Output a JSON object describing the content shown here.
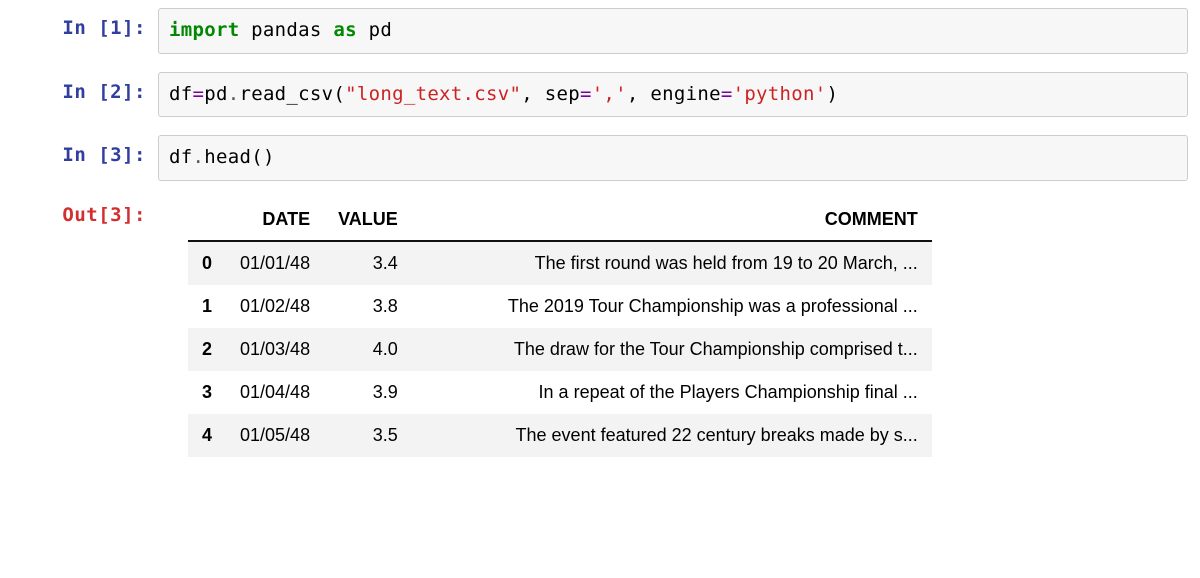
{
  "cells": {
    "in1_prompt": "In [1]:",
    "in2_prompt": "In [2]:",
    "in3_prompt": "In [3]:",
    "out3_prompt": "Out[3]:"
  },
  "code1": {
    "kw_import": "import",
    "name_pandas": " pandas ",
    "kw_as": "as",
    "name_pd": " pd"
  },
  "code2": {
    "name_df": "df",
    "op_eq": "=",
    "name_pd": "pd",
    "dot": ".",
    "fn": "read_csv",
    "lp": "(",
    "str_file": "\"long_text.csv\"",
    "comma1": ", ",
    "arg_sep": "sep",
    "eq1": "=",
    "str_sep": "','",
    "comma2": ", ",
    "arg_engine": "engine",
    "eq2": "=",
    "str_engine": "'python'",
    "rp": ")"
  },
  "code3": {
    "name_df": "df",
    "dot": ".",
    "fn": "head",
    "lp": "(",
    "rp": ")"
  },
  "df": {
    "columns": {
      "date": "DATE",
      "value": "VALUE",
      "comment": "COMMENT"
    },
    "rows": [
      {
        "idx": "0",
        "date": "01/01/48",
        "value": "3.4",
        "comment": "The first round was held from 19 to 20 March, ..."
      },
      {
        "idx": "1",
        "date": "01/02/48",
        "value": "3.8",
        "comment": "The 2019 Tour Championship was a professional ..."
      },
      {
        "idx": "2",
        "date": "01/03/48",
        "value": "4.0",
        "comment": "The draw for the Tour Championship comprised t..."
      },
      {
        "idx": "3",
        "date": "01/04/48",
        "value": "3.9",
        "comment": "In a repeat of the Players Championship final ..."
      },
      {
        "idx": "4",
        "date": "01/05/48",
        "value": "3.5",
        "comment": "The event featured 22 century breaks made by s..."
      }
    ]
  }
}
